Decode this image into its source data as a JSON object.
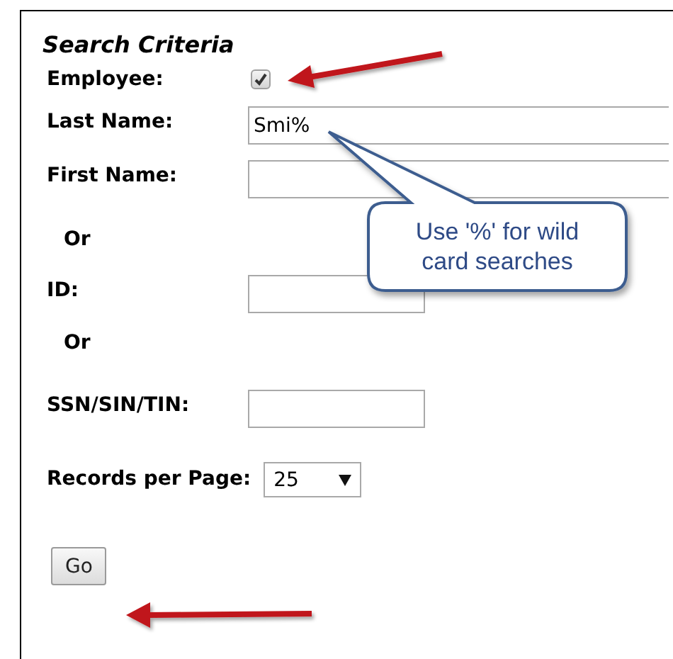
{
  "title": "Search Criteria",
  "fields": [
    {
      "kind": "checkbox",
      "label": "Employee:",
      "checked": true
    },
    {
      "kind": "text",
      "label": "Last Name:",
      "value": "Smi%"
    },
    {
      "kind": "text",
      "label": "First Name:"
    },
    {
      "kind": "separator",
      "label": "Or"
    },
    {
      "kind": "short",
      "label": "ID:"
    },
    {
      "kind": "separator",
      "label": "Or"
    },
    {
      "kind": "short",
      "label": "SSN/SIN/TIN:"
    },
    {
      "kind": "select",
      "label": "Records per Page:",
      "value": "25"
    },
    {
      "kind": "button",
      "label": "Go"
    }
  ],
  "callout": {
    "text": "Use '%' for wild card searches"
  }
}
